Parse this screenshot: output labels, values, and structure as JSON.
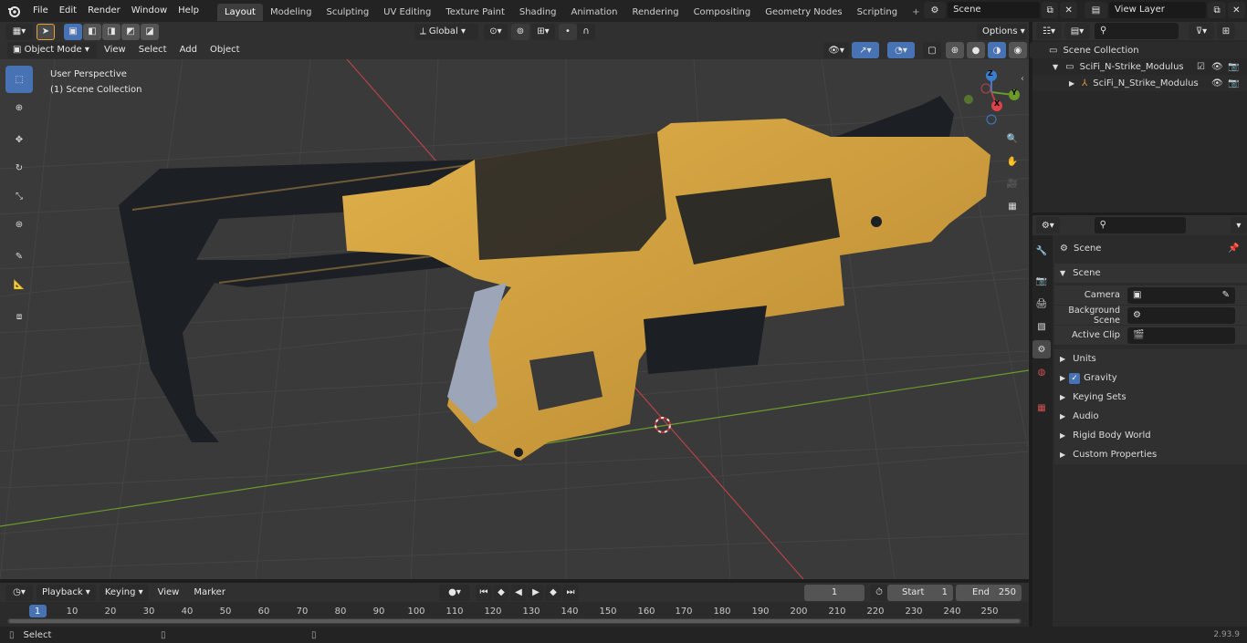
{
  "menubar": {
    "items": [
      "File",
      "Edit",
      "Render",
      "Window",
      "Help"
    ]
  },
  "workspaces": {
    "tabs": [
      "Layout",
      "Modeling",
      "Sculpting",
      "UV Editing",
      "Texture Paint",
      "Shading",
      "Animation",
      "Rendering",
      "Compositing",
      "Geometry Nodes",
      "Scripting"
    ],
    "active": "Layout",
    "add_symbol": "+"
  },
  "scene_selector": {
    "value": "Scene"
  },
  "viewlayer_selector": {
    "value": "View Layer"
  },
  "viewport_header": {
    "mode": "Object Mode",
    "menus": [
      "View",
      "Select",
      "Add",
      "Object"
    ],
    "orientation": "Global",
    "options": "Options"
  },
  "viewport": {
    "perspective_label": "User Perspective",
    "collection_label": "(1) Scene Collection",
    "gizmo_axes": {
      "z": "Z",
      "y": "Y",
      "x": "X"
    },
    "colors": {
      "x_axis": "#b8434a",
      "y_axis": "#6b9a2a",
      "z_axis": "#3b7ed0",
      "model_yellow": "#d9a640",
      "model_dark": "#1c1f24"
    }
  },
  "toolbar": {
    "tools": [
      "select-box-icon",
      "cursor-icon",
      "move-icon",
      "rotate-icon",
      "scale-icon",
      "transform-icon",
      "annotate-icon",
      "measure-icon",
      "add-cube-icon"
    ]
  },
  "outliner": {
    "search_placeholder": "",
    "root": "Scene Collection",
    "items": [
      {
        "label": "SciFi_N-Strike_Modulus",
        "level": 1
      },
      {
        "label": "SciFi_N_Strike_Modulus",
        "level": 2
      }
    ]
  },
  "properties": {
    "context_label": "Scene",
    "section": "Scene",
    "fields": [
      {
        "label": "Camera",
        "value": ""
      },
      {
        "label": "Background Scene",
        "value": ""
      },
      {
        "label": "Active Clip",
        "value": ""
      }
    ],
    "panels": [
      "Units",
      "Gravity",
      "Keying Sets",
      "Audio",
      "Rigid Body World",
      "Custom Properties"
    ]
  },
  "timeline": {
    "menus": [
      "Playback",
      "Keying",
      "View",
      "Marker"
    ],
    "current_frame": "1",
    "start_label": "Start",
    "start_value": "1",
    "end_label": "End",
    "end_value": "250",
    "ticks": [
      "1",
      "10",
      "20",
      "30",
      "40",
      "50",
      "60",
      "70",
      "80",
      "90",
      "100",
      "110",
      "120",
      "130",
      "140",
      "150",
      "160",
      "170",
      "180",
      "190",
      "200",
      "210",
      "220",
      "230",
      "240",
      "250"
    ]
  },
  "statusbar": {
    "left": "Select",
    "version": "2.93.9"
  }
}
